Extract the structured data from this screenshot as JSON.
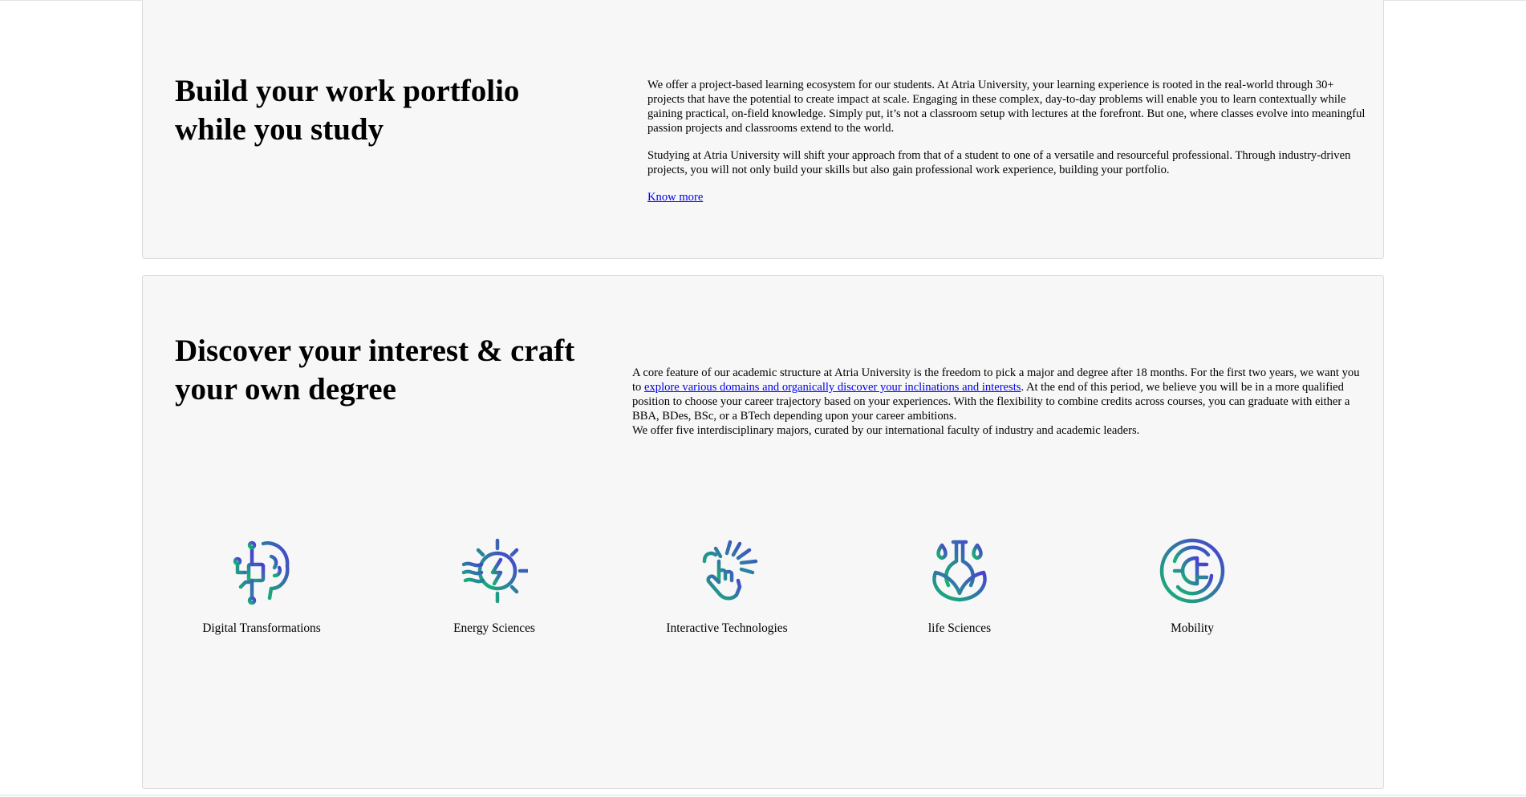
{
  "portfolio": {
    "title": "Build your work portfolio while you study",
    "paragraph1": "We offer a project-based learning ecosystem for our students. At Atria University, your learning experience is rooted in the real-world through 30+ projects that have the potential to create impact at scale. Engaging in these complex, day-to-day problems will enable you to learn contextually while gaining practical, on-field knowledge. Simply put, it’s not a classroom setup with lectures at the forefront. But one, where classes evolve into meaningful passion projects and classrooms extend to the world.",
    "paragraph2": "Studying at Atria University will shift your approach from that of a student to one of a versatile and resourceful professional. Through industry-driven projects, you will not only build your skills but also gain professional work experience, building your portfolio.",
    "link_label": "Know more"
  },
  "degree": {
    "title": "Discover your interest & craft your own degree",
    "text_before_link": "A core feature of our academic structure at Atria University is the freedom to pick a major and degree after 18 months. For the first two years, we want you to ",
    "link_label": "explore various domains and organically discover your inclinations and interests",
    "text_after_link": ". At the end of this period, we believe you will be in a more qualified position to choose your career trajectory based on your experiences. With the flexibility to combine credits across courses, you can graduate with either a BBA, BDes, BSc, or a BTech depending upon your career ambitions.",
    "text_line2": "We offer five interdisciplinary majors, curated by our international faculty of industry and academic leaders.",
    "majors": [
      {
        "label": "Digital Transformations",
        "icon": "brain-circuit-icon"
      },
      {
        "label": "Energy Sciences",
        "icon": "energy-gear-icon"
      },
      {
        "label": "Interactive Technologies",
        "icon": "touch-hand-icon"
      },
      {
        "label": "life Sciences",
        "icon": "flask-leaf-icon"
      },
      {
        "label": "Mobility",
        "icon": "plug-circle-icon"
      }
    ]
  },
  "colors": {
    "gradient_start": "#14b86e",
    "gradient_end": "#4a3ed6",
    "card_bg": "#f7f7f7",
    "link": "#0000ee"
  }
}
